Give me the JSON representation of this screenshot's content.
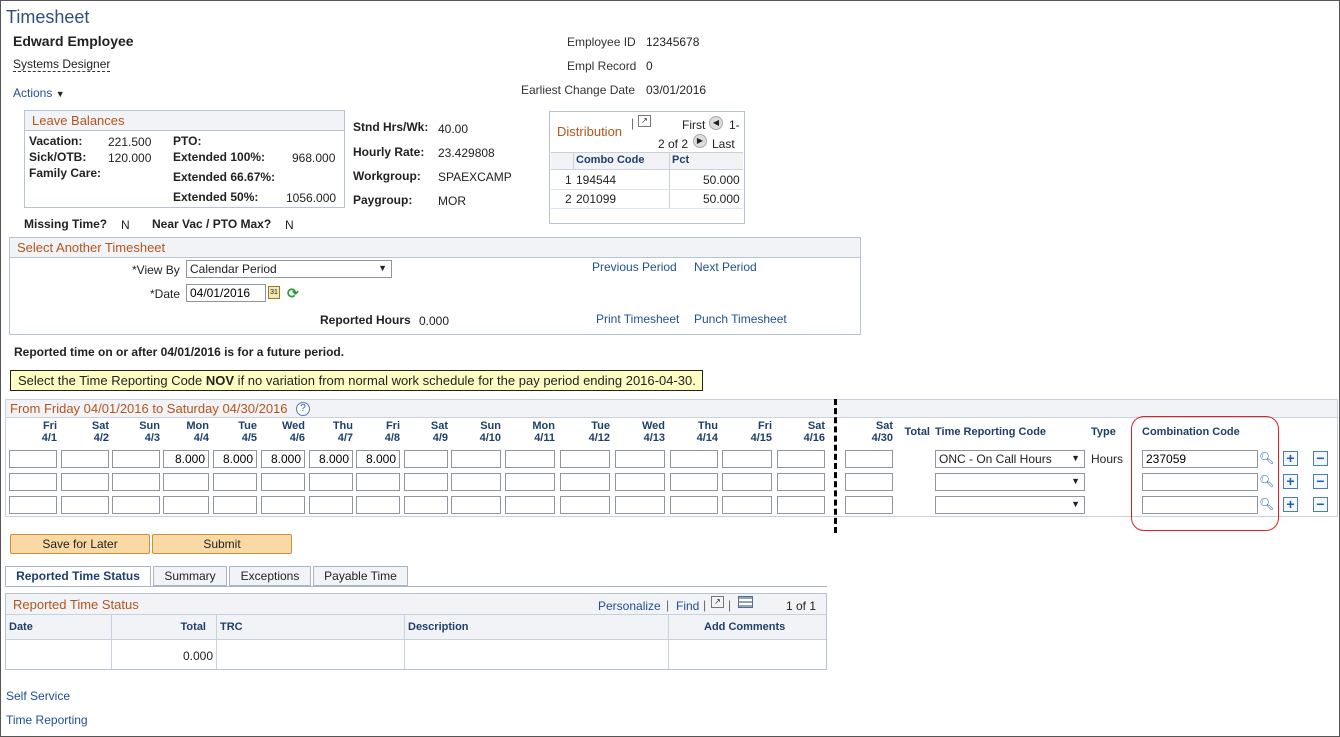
{
  "page": {
    "title": "Timesheet"
  },
  "employee": {
    "name": "Edward Employee",
    "job_title": "Systems Designer",
    "id_label": "Employee ID",
    "id": "12345678",
    "rec_label": "Empl Record",
    "rec": "0",
    "ecd_label": "Earliest Change Date",
    "ecd": "03/01/2016"
  },
  "actions": {
    "label": "Actions"
  },
  "leave": {
    "title": "Leave Balances",
    "vacation_label": "Vacation:",
    "vacation": "221.500",
    "pto_label": "PTO:",
    "sick_label": "Sick/OTB:",
    "sick": "120.000",
    "ext100_label": "Extended 100%:",
    "ext100": "968.000",
    "family_label": "Family Care:",
    "ext66_label": "Extended 66.67%:",
    "ext50_label": "Extended 50%:",
    "ext50": "1056.000"
  },
  "info": {
    "stnd_label": "Stnd Hrs/Wk:",
    "stnd": "40.00",
    "rate_label": "Hourly Rate:",
    "rate": "23.429808",
    "wg_label": "Workgroup:",
    "wg": "SPAEXCAMP",
    "pg_label": "Paygroup:",
    "pg": "MOR"
  },
  "distribution": {
    "title": "Distribution",
    "first": "First",
    "range1": "1-",
    "range2": "2 of 2",
    "last": "Last",
    "col_combo": "Combo Code",
    "col_pct": "Pct",
    "rows": [
      {
        "n": "1",
        "code": "194544",
        "pct": "50.000"
      },
      {
        "n": "2",
        "code": "201099",
        "pct": "50.000"
      }
    ]
  },
  "missing": {
    "label": "Missing Time?",
    "value": "N",
    "near_label": "Near Vac / PTO Max?",
    "near_value": "N"
  },
  "another": {
    "title": "Select Another Timesheet",
    "viewby_label": "*View By",
    "viewby_value": "Calendar Period",
    "date_label": "*Date",
    "date_value": "04/01/2016",
    "reported_label": "Reported Hours",
    "reported_value": "0.000",
    "prev": "Previous Period",
    "next": "Next Period",
    "print": "Print Timesheet",
    "punch": "Punch Timesheet"
  },
  "notice": {
    "future": "Reported time on or after 04/01/2016 is for a future period.",
    "banner_pre": "Select the Time Reporting Code ",
    "banner_bold": "NOV",
    "banner_post": " if no variation from normal work schedule for the pay period ending 2016-04-30."
  },
  "grid": {
    "period": "From Friday 04/01/2016 to Saturday 04/30/2016",
    "days": [
      {
        "d": "Fri",
        "n": "4/1"
      },
      {
        "d": "Sat",
        "n": "4/2"
      },
      {
        "d": "Sun",
        "n": "4/3"
      },
      {
        "d": "Mon",
        "n": "4/4"
      },
      {
        "d": "Tue",
        "n": "4/5"
      },
      {
        "d": "Wed",
        "n": "4/6"
      },
      {
        "d": "Thu",
        "n": "4/7"
      },
      {
        "d": "Fri",
        "n": "4/8"
      },
      {
        "d": "Sat",
        "n": "4/9"
      },
      {
        "d": "Sun",
        "n": "4/10"
      },
      {
        "d": "Mon",
        "n": "4/11"
      },
      {
        "d": "Tue",
        "n": "4/12"
      },
      {
        "d": "Wed",
        "n": "4/13"
      },
      {
        "d": "Thu",
        "n": "4/14"
      },
      {
        "d": "Fri",
        "n": "4/15"
      },
      {
        "d": "Sat",
        "n": "4/16"
      },
      {
        "d": "Sat",
        "n": "4/30"
      }
    ],
    "total_label": "Total",
    "trc_label": "Time Reporting Code",
    "type_label": "Type",
    "combo_label": "Combination Code",
    "row1_values": [
      "",
      "",
      "",
      "8.000",
      "8.000",
      "8.000",
      "8.000",
      "8.000",
      "",
      "",
      "",
      "",
      "",
      "",
      "",
      "",
      ""
    ],
    "row1_trc": "ONC - On Call Hours",
    "row1_type": "Hours",
    "row1_combo": "237059",
    "highlight_color": "#e02020"
  },
  "buttons": {
    "save": "Save for Later",
    "submit": "Submit"
  },
  "tabs": [
    "Reported Time Status",
    "Summary",
    "Exceptions",
    "Payable Time"
  ],
  "status": {
    "title": "Reported Time Status",
    "personalize": "Personalize",
    "find": "Find",
    "count": "1 of 1",
    "cols": [
      "Date",
      "Total",
      "TRC",
      "Description",
      "Add Comments"
    ],
    "row_total": "0.000"
  },
  "footer": {
    "self_service": "Self Service",
    "time_reporting": "Time Reporting"
  }
}
